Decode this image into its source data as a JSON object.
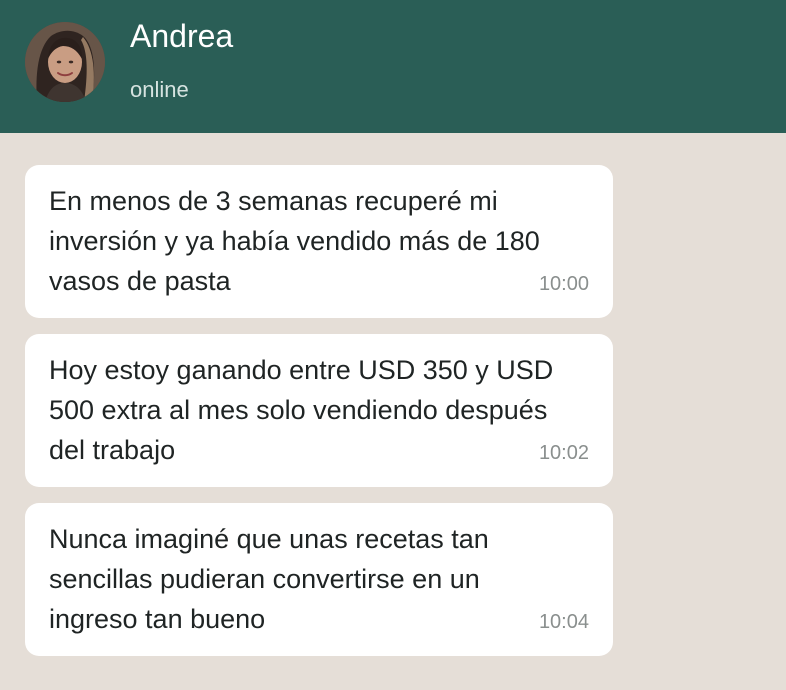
{
  "header": {
    "name": "Andrea",
    "status": "online",
    "background_color": "#2A5E56"
  },
  "messages": [
    {
      "text": "En menos de 3 semanas recuperé mi inversión y ya había vendido más de 180 vasos de pasta",
      "time": "10:00"
    },
    {
      "text": "Hoy estoy ganando entre USD 350 y USD 500 extra al mes solo vendiendo después del trabajo",
      "time": "10:02"
    },
    {
      "text": "Nunca imaginé que unas recetas tan sencillas pudieran convertirse en un ingreso tan bueno",
      "time": "10:04"
    }
  ],
  "colors": {
    "chat_background": "#E5DED7",
    "bubble_background": "#FFFFFF",
    "text": "#1F2424",
    "timestamp": "#8A8F8E"
  }
}
